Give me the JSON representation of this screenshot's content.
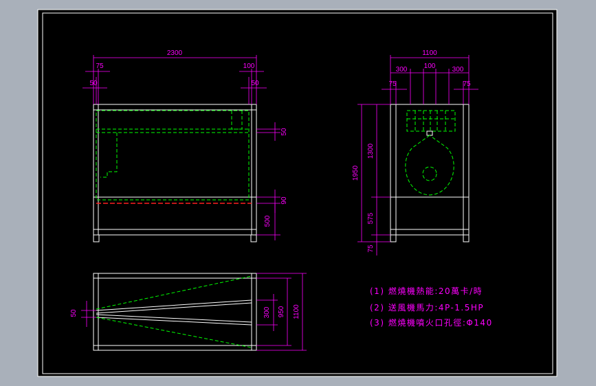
{
  "front_view": {
    "overall_width": "2300",
    "left_offset_1": "75",
    "right_offset_1": "100",
    "left_offset_2": "50",
    "right_offset_2": "50",
    "right_dim_50": "50",
    "right_dim_90": "90",
    "right_dim_500": "500"
  },
  "side_view": {
    "overall_width": "1100",
    "left_300": "300",
    "center_100": "100",
    "right_300": "300",
    "left_75": "75",
    "right_75": "75",
    "height_1950": "1950",
    "height_1300": "1300",
    "height_575": "575",
    "height_75": "75"
  },
  "top_view": {
    "left_50": "50",
    "dim_300": "300",
    "dim_950": "950",
    "dim_1100": "1100"
  },
  "notes": [
    "(1) 燃燒機熱能:20萬卡/時",
    "(2) 送風機馬力:4P-1.5HP",
    "(3) 燃燒機噴火口孔徑:Φ140"
  ],
  "colors": {
    "background": "#000000",
    "frame": "#ffffff",
    "dimension": "#ff00ff",
    "hidden": "#00ff00",
    "red_line": "#ff2020"
  }
}
